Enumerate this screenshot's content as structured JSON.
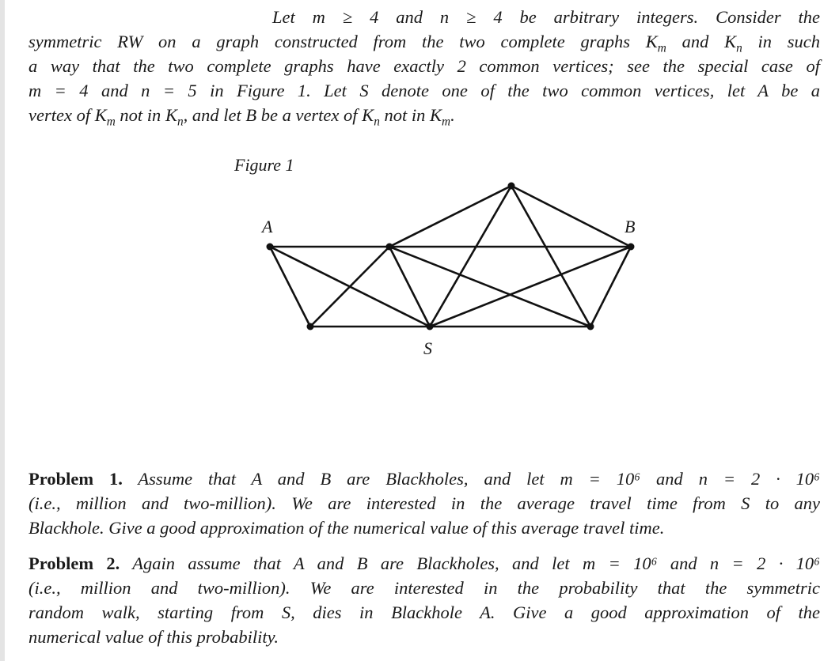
{
  "document": {
    "intro": {
      "lines": [
        "Let m ≥ 4 and n ≥ 4 be arbitrary integers. Consider the",
        "symmetric RW on a graph constructed from the two complete graphs K_m and K_n in such",
        "a way that the two complete graphs have exactly 2 common vertices; see the special case of",
        "m = 4 and n = 5 in Figure 1. Let S denote one of the two common vertices, let A be a",
        "vertex of K_m not in K_n, and let B be a vertex of K_n not in K_m."
      ]
    },
    "figure": {
      "caption": "Figure 1",
      "vertex_labels": {
        "A": "A",
        "B": "B",
        "S": "S"
      },
      "vertices": [
        "A",
        "M",
        "T",
        "B",
        "BL",
        "S",
        "BR"
      ],
      "edges": [
        [
          "A",
          "M"
        ],
        [
          "A",
          "BL"
        ],
        [
          "A",
          "S"
        ],
        [
          "M",
          "BL"
        ],
        [
          "M",
          "S"
        ],
        [
          "BL",
          "S"
        ],
        [
          "M",
          "T"
        ],
        [
          "M",
          "B"
        ],
        [
          "M",
          "BR"
        ],
        [
          "T",
          "B"
        ],
        [
          "T",
          "S"
        ],
        [
          "T",
          "BR"
        ],
        [
          "B",
          "S"
        ],
        [
          "B",
          "BR"
        ],
        [
          "S",
          "BR"
        ]
      ],
      "m": 4,
      "n": 5
    },
    "problems": [
      {
        "label": "Problem 1.",
        "lines": [
          "Assume that A and B are Blackholes, and let m = 10⁶ and n = 2 · 10⁶",
          "(i.e., million and two-million). We are interested in the average travel time from S to any",
          "Blackhole. Give a good approximation of the numerical value of this average travel time."
        ]
      },
      {
        "label": "Problem 2.",
        "lines": [
          "Again assume that A and B are Blackholes, and let m = 10⁶ and n = 2 · 10⁶",
          "(i.e., million and two-million). We are interested in the probability that the symmetric",
          "random walk, starting from S, dies in Blackhole A. Give a good approximation of the",
          "numerical value of this probability."
        ]
      }
    ]
  }
}
